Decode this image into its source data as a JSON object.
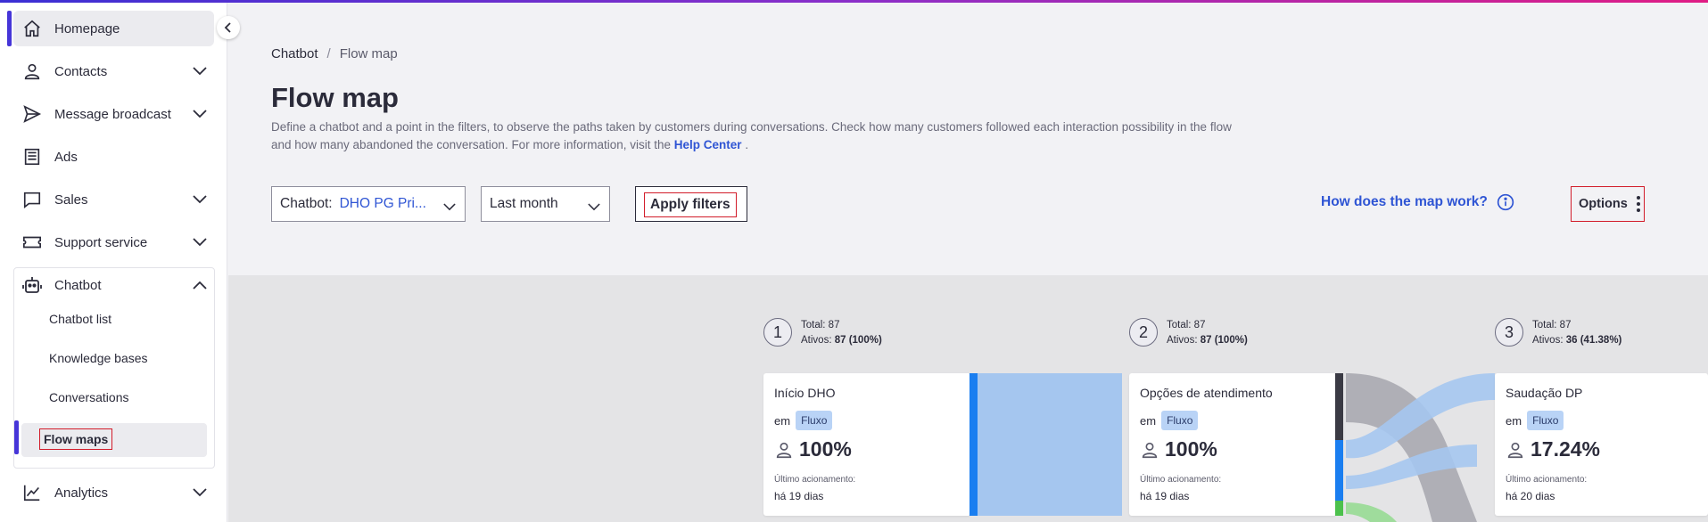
{
  "sidebar": {
    "items": [
      {
        "label": "Homepage",
        "icon": "home-icon"
      },
      {
        "label": "Contacts",
        "icon": "user-icon"
      },
      {
        "label": "Message broadcast",
        "icon": "send-icon"
      },
      {
        "label": "Ads",
        "icon": "document-icon"
      },
      {
        "label": "Sales",
        "icon": "chat-icon"
      },
      {
        "label": "Support service",
        "icon": "ticket-icon"
      },
      {
        "label": "Chatbot",
        "icon": "robot-icon"
      },
      {
        "label": "Analytics",
        "icon": "chart-line-icon"
      }
    ],
    "chatbot_sub": [
      "Chatbot list",
      "Knowledge bases",
      "Conversations",
      "Flow maps"
    ]
  },
  "breadcrumb": {
    "root": "Chatbot",
    "separator": "/",
    "current": "Flow map"
  },
  "page": {
    "title": "Flow map",
    "description": "Define a chatbot and a point in the filters, to observe the paths taken by customers during conversations. Check how many customers followed each interaction possibility in the flow and how many abandoned the conversation. For more information, visit the",
    "help_link": "Help Center",
    "description_end": "."
  },
  "filters": {
    "chatbot_label": "Chatbot:",
    "chatbot_value": "DHO PG Pri...",
    "period_value": "Last month",
    "apply_label": "Apply filters"
  },
  "how_link": "How does the map work?",
  "options_label": "Options",
  "steps": [
    {
      "num": "1",
      "total": "Total: 87",
      "active_label": "Ativos:",
      "active_value": "87 (100%)"
    },
    {
      "num": "2",
      "total": "Total: 87",
      "active_label": "Ativos:",
      "active_value": "87 (100%)"
    },
    {
      "num": "3",
      "total": "Total: 87",
      "active_label": "Ativos:",
      "active_value": "36 (41.38%)"
    }
  ],
  "cards": [
    {
      "name": "Início DHO",
      "em": "em",
      "badge": "Fluxo",
      "pct": "100%",
      "last_label": "Último acionamento:",
      "last_value": "há 19 dias"
    },
    {
      "name": "Opções de atendimento",
      "em": "em",
      "badge": "Fluxo",
      "pct": "100%",
      "last_label": "Último acionamento:",
      "last_value": "há 19 dias"
    },
    {
      "name": "Saudação DP",
      "em": "em",
      "badge": "Fluxo",
      "pct": "17.24%",
      "last_label": "Último acionamento:",
      "last_value": "há 20 dias"
    }
  ],
  "colors": {
    "accent": "#4635d8",
    "link": "#2f55d4",
    "flow_blue": "#a5c6ef",
    "bar_blue": "#1a7ef0"
  }
}
